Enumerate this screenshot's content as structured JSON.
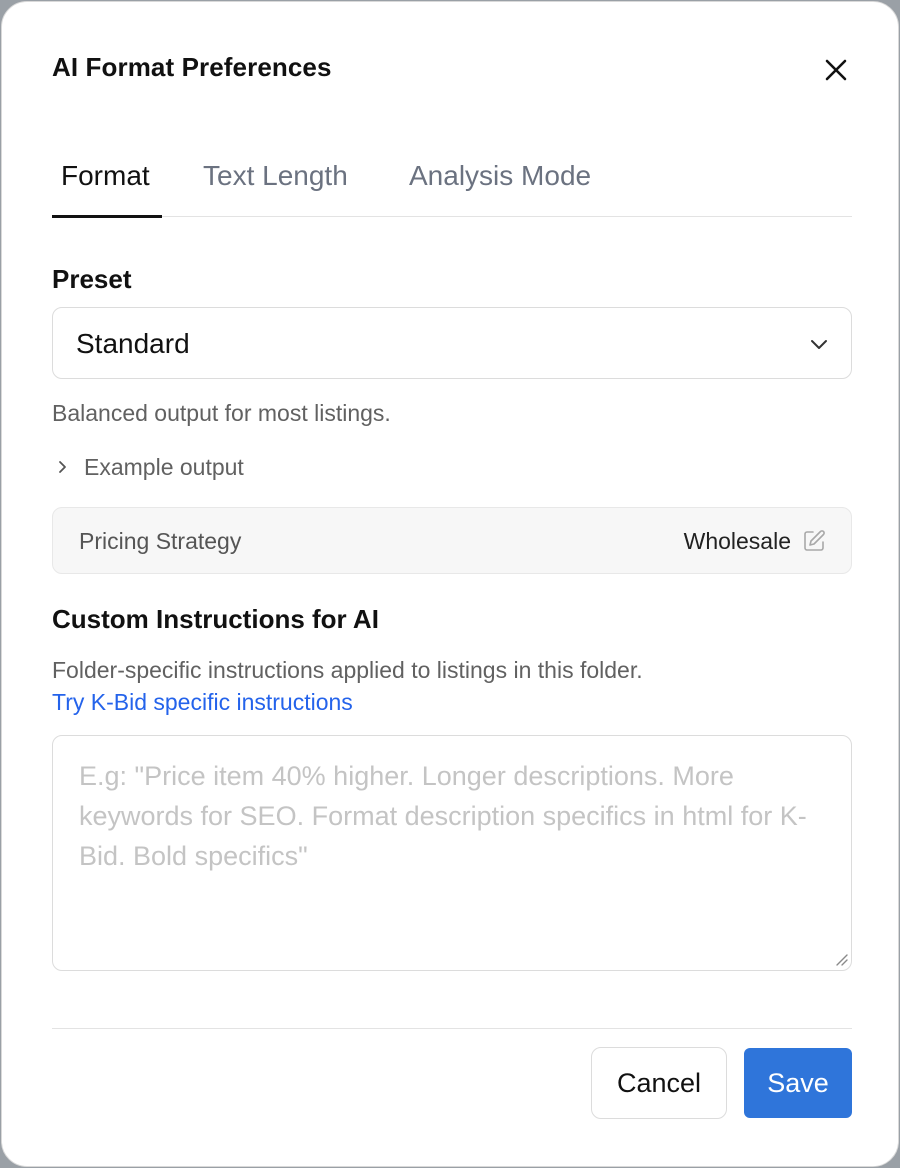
{
  "dialog": {
    "title": "AI Format Preferences",
    "close_icon": "close-icon"
  },
  "tabs": [
    {
      "label": "Format",
      "active": true
    },
    {
      "label": "Text Length",
      "active": false
    },
    {
      "label": "Analysis Mode",
      "active": false
    }
  ],
  "preset": {
    "label": "Preset",
    "selected": "Standard",
    "description": "Balanced output for most listings.",
    "example_toggle": "Example output"
  },
  "pricing": {
    "label": "Pricing Strategy",
    "value": "Wholesale",
    "edit_icon": "edit-icon"
  },
  "custom": {
    "label": "Custom Instructions for AI",
    "description": "Folder-specific instructions applied to listings in this folder.",
    "link": "Try K-Bid specific instructions",
    "placeholder": "E.g: \"Price item 40% higher. Longer descriptions. More keywords for SEO. Format description specifics in html for K-Bid. Bold specifics\"",
    "value": ""
  },
  "footer": {
    "cancel_label": "Cancel",
    "save_label": "Save"
  },
  "colors": {
    "accent": "#2f75da",
    "link": "#2463eb"
  }
}
